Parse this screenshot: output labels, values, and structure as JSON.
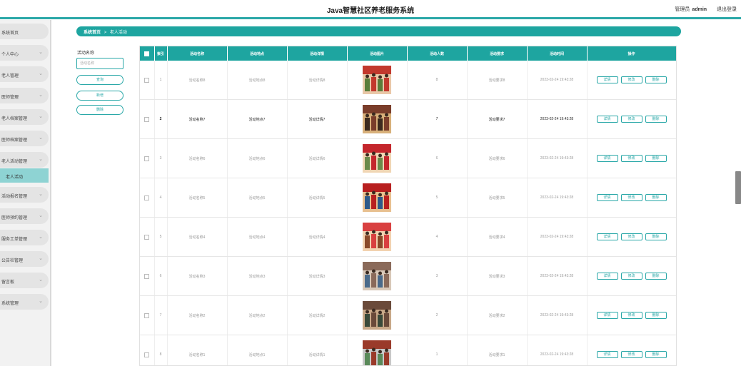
{
  "header": {
    "title": "Java智慧社区养老服务系统",
    "role": "管理员",
    "username": "admin",
    "logout": "退出登录"
  },
  "sidebar": {
    "items": [
      {
        "label": "系统首页",
        "chevron": false
      },
      {
        "label": "个人中心",
        "chevron": true
      },
      {
        "label": "老人管理",
        "chevron": true
      },
      {
        "label": "医师管理",
        "chevron": true
      },
      {
        "label": "老人档案管理",
        "chevron": true
      },
      {
        "label": "医师档案管理",
        "chevron": true
      },
      {
        "label": "老人活动管理",
        "chevron": true
      },
      {
        "label": "活动报名管理",
        "chevron": true
      },
      {
        "label": "医师预约管理",
        "chevron": true
      },
      {
        "label": "服务工单管理",
        "chevron": true
      },
      {
        "label": "公告栏管理",
        "chevron": true
      },
      {
        "label": "留言板",
        "chevron": true
      },
      {
        "label": "系统管理",
        "chevron": true
      }
    ],
    "active_sub": "老人活动"
  },
  "breadcrumb": {
    "home": "系统首页",
    "sep": ">",
    "current": "老人活动"
  },
  "search": {
    "label": "活动名称",
    "placeholder": "活动名称",
    "query_btn": "查询",
    "add_btn": "新增",
    "delete_btn": "删除"
  },
  "table": {
    "columns": [
      "索引",
      "活动名称",
      "活动地点",
      "活动详情",
      "活动图片",
      "活动人数",
      "活动要求",
      "活动时间",
      "操作"
    ],
    "actions": {
      "detail": "详情",
      "edit": "修改",
      "delete": "删除"
    },
    "rows": [
      {
        "index": "1",
        "name": "活动名称8",
        "place": "活动地点8",
        "detail": "活动详情8",
        "count": "8",
        "req": "活动要求8",
        "time": "2023-02-24 19:43:28",
        "highlight": false
      },
      {
        "index": "2",
        "name": "活动名称7",
        "place": "活动地点7",
        "detail": "活动详情7",
        "count": "7",
        "req": "活动要求7",
        "time": "2023-02-24 19:43:28",
        "highlight": true
      },
      {
        "index": "3",
        "name": "活动名称6",
        "place": "活动地点6",
        "detail": "活动详情6",
        "count": "6",
        "req": "活动要求6",
        "time": "2023-02-24 19:43:28",
        "highlight": false
      },
      {
        "index": "4",
        "name": "活动名称5",
        "place": "活动地点5",
        "detail": "活动详情5",
        "count": "5",
        "req": "活动要求5",
        "time": "2023-02-24 19:43:28",
        "highlight": false
      },
      {
        "index": "5",
        "name": "活动名称4",
        "place": "活动地点4",
        "detail": "活动详情4",
        "count": "4",
        "req": "活动要求4",
        "time": "2023-02-24 19:43:28",
        "highlight": false
      },
      {
        "index": "6",
        "name": "活动名称3",
        "place": "活动地点3",
        "detail": "活动详情3",
        "count": "3",
        "req": "活动要求3",
        "time": "2023-02-24 19:43:28",
        "highlight": false
      },
      {
        "index": "7",
        "name": "活动名称2",
        "place": "活动地点2",
        "detail": "活动详情2",
        "count": "2",
        "req": "活动要求2",
        "time": "2023-02-24 19:43:28",
        "highlight": false
      },
      {
        "index": "8",
        "name": "活动名称1",
        "place": "活动地点1",
        "detail": "活动详情1",
        "count": "1",
        "req": "活动要求1",
        "time": "2023-02-24 19:43:28",
        "highlight": false
      }
    ]
  },
  "colors": {
    "accent": "#1ea5a0",
    "sidebar_active": "#8ed3d3"
  }
}
